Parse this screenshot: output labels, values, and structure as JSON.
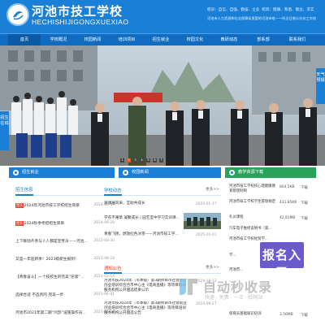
{
  "header": {
    "school_name": "河池市技工学校",
    "school_pinyin": "HECHISHIJIGONGXUEXIAO",
    "top_links": "校训：自信、自强、勤奋、立业",
    "top_links_right": "校风：健康、和谐、敬业、求实",
    "slogan": "河池市人力资源和社会保障局直管的河池市唯一一所全日制公办技工学校"
  },
  "nav": {
    "items": [
      "首页",
      "学校概况",
      "校园新闻",
      "培训项目",
      "招生就业",
      "校园文化",
      "教研动态",
      "部系部",
      "联系我们"
    ],
    "active_index": 0
  },
  "banner": {
    "float_left_label": "招生在线",
    "float_right_label": "天气预报",
    "dots": [
      "1",
      "2",
      "3",
      "4",
      "5",
      "6",
      "7"
    ],
    "active_dot": 1
  },
  "sections": {
    "admissions": {
      "bar_label": "招生就业",
      "panel_title": "招生信息"
    },
    "news": {
      "bar_label": "校园新闻",
      "panel_title": "学校动态",
      "more": "更多>>"
    },
    "notices": {
      "panel_title": "通知公告",
      "more": "更多>>"
    },
    "downloads": {
      "bar_label": "教学资源下载"
    }
  },
  "admissions_news": [
    {
      "tag": "置顶",
      "text": "2024年河池市技工学校招生简章",
      "date": "2024-03-09"
    },
    {
      "tag": "置顶",
      "text": "2024秋季考招招生简章",
      "date": "2024-06-20"
    },
    {
      "tag": "",
      "text": "上下联动齐参与人人都是宣传员——河池...",
      "date": "2022-03-30"
    },
    {
      "tag": "",
      "text": "又是一年迎新季！2023级新生报到！",
      "date": "2021-08-24"
    },
    {
      "tag": "",
      "text": "【青春奋斗】一个技校生的完美“逆袭”...",
      "date": "2021-03-14"
    },
    {
      "tag": "",
      "text": "选择合适 不选贵的 完美一步",
      "date": "2021-06-01"
    },
    {
      "tag": "",
      "text": "河池市2021年第二期“鸿鹄”设施操作员...",
      "date": "2021-04-23"
    }
  ],
  "campus_news": [
    {
      "text": "速课展风采，互助共成长",
      "date": "2025-01-17"
    },
    {
      "text": "学农不难草 凝聚成长 | 园艺室中学习实训课...",
      "date": "2025-01-17"
    },
    {
      "text": "青春飞扬，燃放红色冰雪——河池市技工学...",
      "date": "2025-01-01"
    }
  ],
  "notices": [
    {
      "text": "河池市技2024年（市本级）第3期项目市社会就业创业培训综合合市中心主《电商直播》等项目培训服务机构公开遴选结果公示",
      "date": "2024-10-12"
    },
    {
      "text": "河池市技2024年（市本级）第3期项目市社会就业创业培训综合合市中心主《电商直播》等项目培训服务机构公开遴选公告",
      "date": "2024-09-27"
    }
  ],
  "downloads": [
    {
      "text": "河池市技工学校校心理健康教育管理制制",
      "size": "804.5KB",
      "action": "下载"
    },
    {
      "text": "河池市技工学校学生管理规定",
      "size": "431.85KB",
      "action": "下载"
    },
    {
      "text": "礼仪课程",
      "size": "42.81MB",
      "action": "下载"
    },
    {
      "text": "汽车电子维修说明书（第...",
      "size": "",
      "action": ""
    },
    {
      "text": "河池市技工学校经贸学...",
      "size": "",
      "action": ""
    },
    {
      "text": "学...",
      "size": "",
      "action": ""
    },
    {
      "text": "河池市...",
      "size": "",
      "action": ""
    },
    {
      "text": "...",
      "size": "",
      "action": ""
    },
    {
      "text": "保育员基础知识培训",
      "size": "3.56MB",
      "action": "下载"
    }
  ],
  "overlays": {
    "baoming": "报名入口",
    "watermark": "自动秒收录",
    "watermark_sub": "快速 · 免费 · 一次 · 给网站"
  },
  "colors": {
    "primary": "#1a7fd6",
    "nav": "#0f6cc1",
    "accent_green": "#2aa35a",
    "tag_red": "#e3462e",
    "dot_active": "#e8541e"
  }
}
